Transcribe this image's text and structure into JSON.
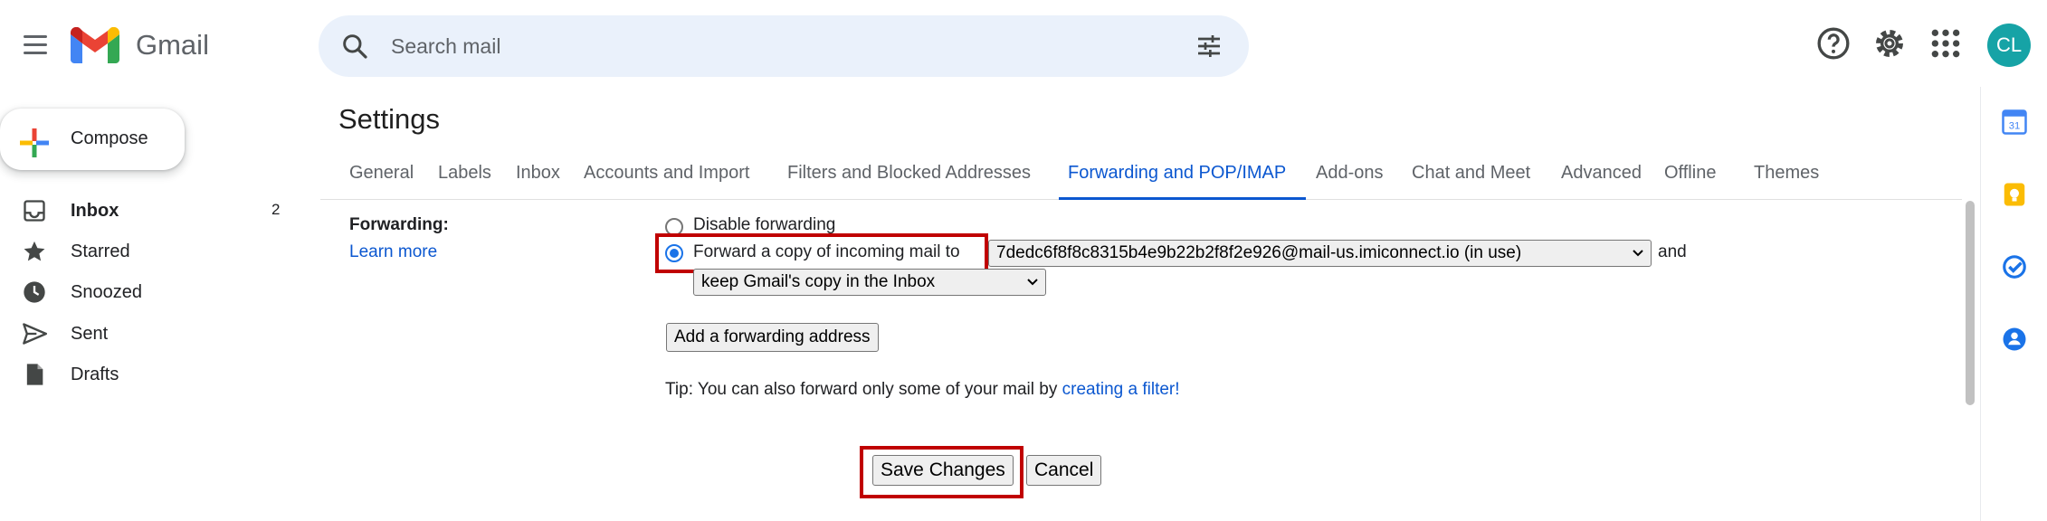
{
  "app": {
    "name": "Gmail",
    "avatar_initials": "CL"
  },
  "search": {
    "placeholder": "Search mail"
  },
  "compose": {
    "label": "Compose"
  },
  "nav": [
    {
      "label": "Inbox",
      "count": "2",
      "icon": "inbox-icon"
    },
    {
      "label": "Starred",
      "count": "",
      "icon": "star-icon"
    },
    {
      "label": "Snoozed",
      "count": "",
      "icon": "clock-icon"
    },
    {
      "label": "Sent",
      "count": "",
      "icon": "send-icon"
    },
    {
      "label": "Drafts",
      "count": "",
      "icon": "draft-icon"
    }
  ],
  "settings": {
    "title": "Settings",
    "tabs": [
      "General",
      "Labels",
      "Inbox",
      "Accounts and Import",
      "Filters and Blocked Addresses",
      "Forwarding and POP/IMAP",
      "Add-ons",
      "Chat and Meet",
      "Advanced",
      "Offline",
      "Themes"
    ],
    "active_tab": "Forwarding and POP/IMAP"
  },
  "forwarding": {
    "label": "Forwarding:",
    "learn_more": "Learn more",
    "disable_label": "Disable forwarding",
    "forward_label": "Forward a copy of incoming mail to",
    "selected": "forward",
    "address_selected": "7dedc6f8f8c8315b4e9b22b2f8f2e926@mail-us.imiconnect.io (in use)",
    "and_text": "and",
    "copy_action_selected": "keep Gmail's copy in the Inbox",
    "add_address_button": "Add a forwarding address",
    "tip_prefix": "Tip: You can also forward only some of your mail by ",
    "tip_link": "creating a filter!"
  },
  "footer": {
    "save_button": "Save Changes",
    "cancel_button": "Cancel"
  },
  "colors": {
    "accent": "#0b57d0",
    "highlight": "#c00000",
    "avatar": "#16a3a6",
    "search_bg": "#eaf1fb"
  }
}
